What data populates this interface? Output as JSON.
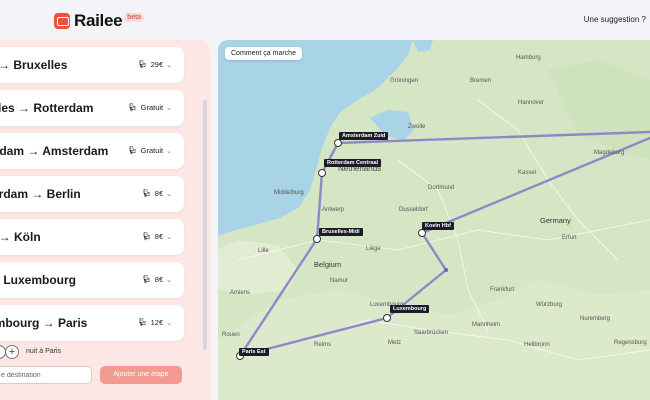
{
  "header": {
    "brand": "Railee",
    "beta": "beta",
    "suggestion": "Une suggestion ?"
  },
  "legs": [
    {
      "name": "s → Bruxelles",
      "price": "29€"
    },
    {
      "name": "elles → Rotterdam",
      "price": "Gratuit"
    },
    {
      "name": "erdam → Amsterdam",
      "price": "Gratuit"
    },
    {
      "name": "terdam → Berlin",
      "price": "8€"
    },
    {
      "name": "n → Köln",
      "price": "8€"
    },
    {
      "name": "→ Luxembourg",
      "price": "8€"
    },
    {
      "name": "embourg → Paris",
      "price": "12€"
    }
  ],
  "nights": {
    "label": "nuit à Paris"
  },
  "destination_input": {
    "placeholder": "e destination"
  },
  "add_step_button": "Ajouter une étape",
  "map": {
    "comment_button": "Comment ça marche",
    "stations": [
      "Amsterdam Zuid",
      "Rotterdam Centraal",
      "Bruxelles-Midi",
      "Koeln Hbf",
      "Luxembourg",
      "Paris Est"
    ],
    "places": {
      "hamburg": "Hamburg",
      "bremen": "Bremen",
      "hannover": "Hannover",
      "magdeburg": "Magdeburg",
      "groningen": "Groningen",
      "zwolle": "Zwolle",
      "netherlands": "Netherlands",
      "antwerp": "Antwerp",
      "middelburg": "Middelburg",
      "belgium": "Belgium",
      "germany": "Germany",
      "dusseldorf": "Dusseldorf",
      "kassel": "Kassel",
      "dortmund": "Dortmund",
      "erfurt": "Erfurt",
      "frankfurt": "Frankfurt",
      "liege": "Liège",
      "namur": "Namur",
      "lille": "Lille",
      "luxembourg": "Luxembourg",
      "wurzburg": "Würzburg",
      "nuremberg": "Nuremberg",
      "heilbronn": "Heilbronn",
      "mannheim": "Mannheim",
      "reims": "Reims",
      "amiens": "Amiens",
      "rouen": "Rouen",
      "metz": "Metz",
      "saarbrucken": "Saarbrücken",
      "regensburg": "Regensburg"
    }
  }
}
